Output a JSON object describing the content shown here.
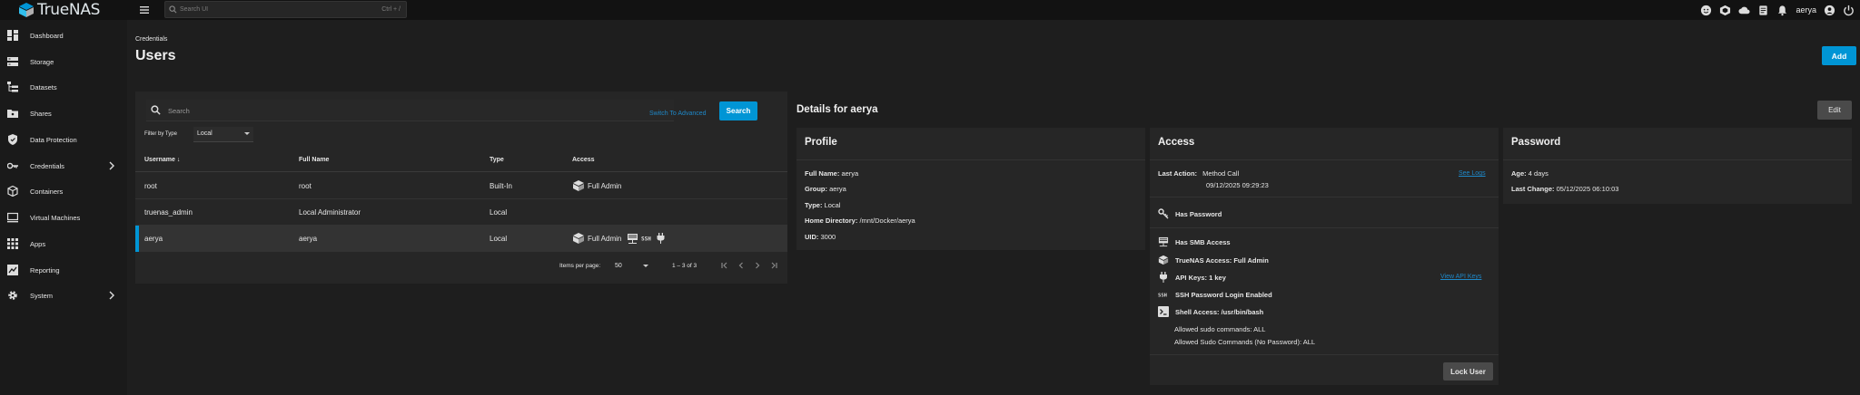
{
  "app": {
    "brand": "TrueNAS"
  },
  "search": {
    "placeholder": "Search UI",
    "shortcut": "Ctrl + /"
  },
  "topbar": {
    "username": "aerya"
  },
  "sidebar": {
    "items": [
      {
        "label": "Dashboard",
        "icon": "dashboard-icon"
      },
      {
        "label": "Storage",
        "icon": "storage-icon"
      },
      {
        "label": "Datasets",
        "icon": "datasets-icon"
      },
      {
        "label": "Shares",
        "icon": "shares-icon"
      },
      {
        "label": "Data Protection",
        "icon": "shield-icon"
      },
      {
        "label": "Credentials",
        "icon": "key-icon",
        "expandable": true
      },
      {
        "label": "Containers",
        "icon": "container-icon"
      },
      {
        "label": "Virtual Machines",
        "icon": "monitor-icon"
      },
      {
        "label": "Apps",
        "icon": "apps-grid-icon"
      },
      {
        "label": "Reporting",
        "icon": "chart-icon"
      },
      {
        "label": "System",
        "icon": "gear-icon",
        "expandable": true
      }
    ]
  },
  "page": {
    "breadcrumb": "Credentials",
    "title": "Users",
    "add_label": "Add"
  },
  "users": {
    "search_placeholder": "Search",
    "advanced_link": "Switch To Advanced",
    "search_button": "Search",
    "filter_label": "Filter by Type",
    "filter_value": "Local",
    "columns": {
      "username": "Username",
      "full_name": "Full Name",
      "type": "Type",
      "access": "Access"
    },
    "rows": [
      {
        "username": "root",
        "full_name": "root",
        "type": "Built-In",
        "access": "Full Admin"
      },
      {
        "username": "truenas_admin",
        "full_name": "Local Administrator",
        "type": "Local",
        "access": ""
      },
      {
        "username": "aerya",
        "full_name": "aerya",
        "type": "Local",
        "access": "Full Admin",
        "selected": true
      }
    ],
    "pager": {
      "items_label": "Items per page:",
      "items_value": "50",
      "range": "1 – 3 of 3"
    }
  },
  "details": {
    "title": "Details for aerya",
    "edit_label": "Edit",
    "profile": {
      "title": "Profile",
      "full_name_label": "Full Name:",
      "full_name": "aerya",
      "group_label": "Group:",
      "group": "aerya",
      "type_label": "Type:",
      "type": "Local",
      "home_label": "Home Directory:",
      "home": "/mnt/Docker/aerya",
      "uid_label": "UID:",
      "uid": "3000"
    },
    "access": {
      "title": "Access",
      "last_action_label": "Last Action:",
      "last_action": "Method Call",
      "last_action_time": "09/12/2025 09:29:23",
      "see_logs": "See Logs",
      "has_password": "Has Password",
      "has_smb": "Has SMB Access",
      "truenas_access": "TrueNAS Access: Full Admin",
      "api_keys": "API Keys: 1 key",
      "view_api_keys": "View API Keys",
      "ssh_password": "SSH Password Login Enabled",
      "shell": "Shell Access: /usr/bin/bash",
      "sudo": "Allowed sudo commands: ALL",
      "sudo_nopass": "Allowed Sudo Commands (No Password): ALL",
      "lock_label": "Lock User"
    },
    "password": {
      "title": "Password",
      "age_label": "Age:",
      "age": "4 days",
      "last_change_label": "Last Change:",
      "last_change": "05/12/2025 06:10:03"
    }
  },
  "colors": {
    "accent": "#0095d5",
    "link": "#1e88c8",
    "background": "#1e1e1e",
    "card": "#262626"
  }
}
